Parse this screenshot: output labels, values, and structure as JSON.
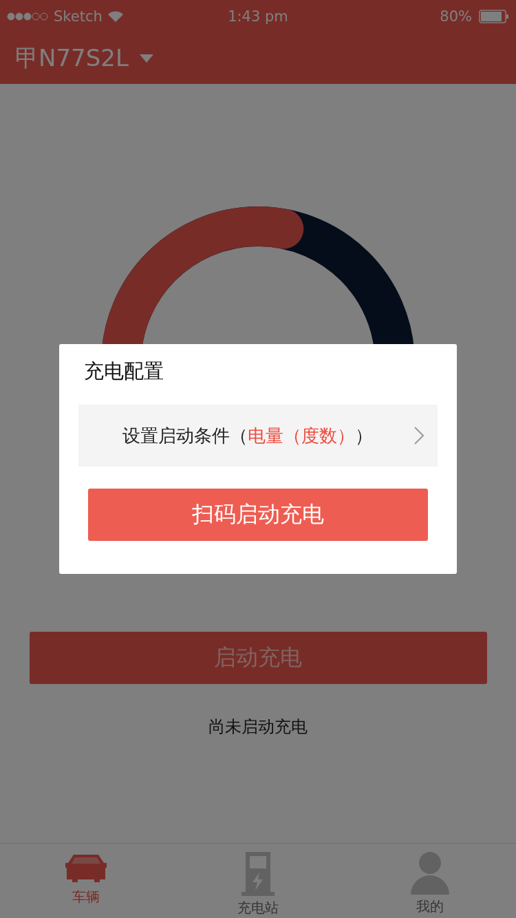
{
  "status_bar": {
    "carrier": "Sketch",
    "time": "1:43 pm",
    "battery": "80%"
  },
  "header": {
    "title": "甲N77S2L"
  },
  "gauge": {
    "level": 0.54
  },
  "start_button": {
    "label": "启动充电"
  },
  "status_text": "尚未启动充电",
  "dialog": {
    "title": "充电配置",
    "condition": {
      "label": "设置启动条件（",
      "value": "电量（度数）",
      "suffix": "）"
    },
    "button": "扫码启动充电"
  },
  "tabs": [
    {
      "kind": "car",
      "label": "车辆",
      "selected": true
    },
    {
      "kind": "station",
      "label": "充电站",
      "selected": false
    },
    {
      "kind": "profile",
      "label": "我的",
      "selected": false
    }
  ]
}
